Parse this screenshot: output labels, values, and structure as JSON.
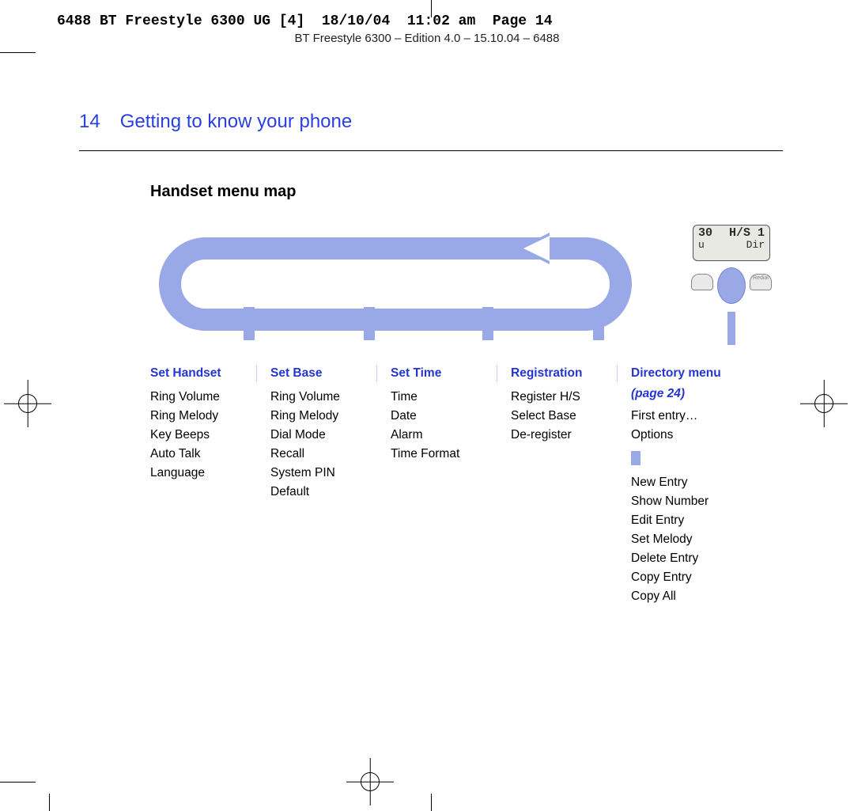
{
  "slug": "6488 BT Freestyle 6300 UG [4]  18/10/04  11:02 am  Page 14",
  "running_head": "BT Freestyle 6300 – Edition 4.0 – 15.10.04 – 6488",
  "page_number": "14",
  "section_title": "Getting to know your phone",
  "subhead": "Handset menu map",
  "handset_lcd": {
    "row1_left": "30",
    "row1_right": "H/S 1",
    "row2_left": "u",
    "row2_right": "Dir"
  },
  "handset_softkeys": {
    "left": "",
    "right": "Redial"
  },
  "menus": {
    "set_handset": {
      "title": "Set Handset",
      "items": [
        "Ring Volume",
        "Ring Melody",
        "Key Beeps",
        "Auto Talk",
        "Language"
      ]
    },
    "set_base": {
      "title": "Set Base",
      "items": [
        "Ring Volume",
        "Ring Melody",
        "Dial Mode",
        "Recall",
        "System PIN",
        "Default"
      ]
    },
    "set_time": {
      "title": "Set Time",
      "items": [
        "Time",
        "Date",
        "Alarm",
        "Time Format"
      ]
    },
    "registration": {
      "title": "Registration",
      "items": [
        "Register H/S",
        "Select Base",
        "De-register"
      ]
    },
    "directory": {
      "title": "Directory menu",
      "page_ref": "(page 24)",
      "top_items": [
        "First entry…",
        "Options"
      ],
      "sub_items": [
        "New Entry",
        "Show Number",
        "Edit Entry",
        "Set Melody",
        "Delete Entry",
        "Copy Entry",
        "Copy All"
      ]
    }
  }
}
